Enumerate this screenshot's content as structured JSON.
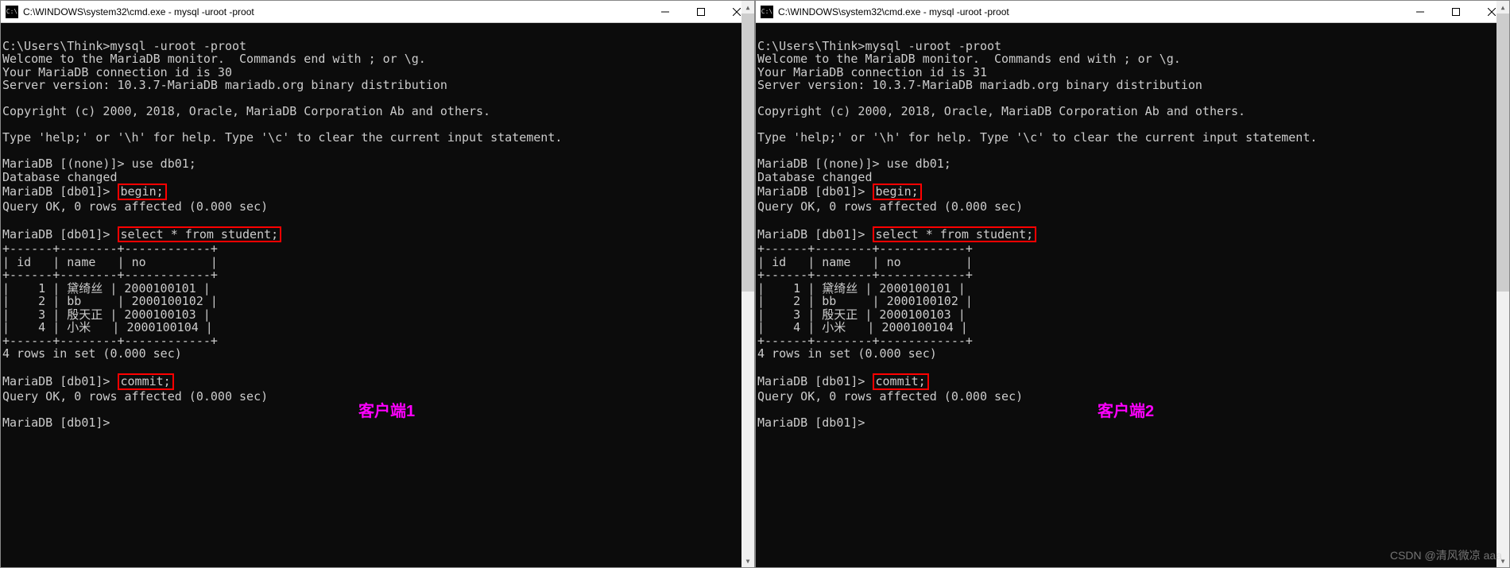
{
  "watermark": "CSDN @清风微凉 aaa",
  "left": {
    "title": "C:\\WINDOWS\\system32\\cmd.exe - mysql  -uroot -proot",
    "icon_label": "C:\\",
    "client_label": "客户端1",
    "session": {
      "login_cmd": "C:\\Users\\Think>mysql -uroot -proot",
      "welcome": "Welcome to the MariaDB monitor.  Commands end with ; or \\g.",
      "conn_id_line": "Your MariaDB connection id is 30",
      "server_version": "Server version: 10.3.7-MariaDB mariadb.org binary distribution",
      "copyright": "Copyright (c) 2000, 2018, Oracle, MariaDB Corporation Ab and others.",
      "help_line": "Type 'help;' or '\\h' for help. Type '\\c' to clear the current input statement.",
      "prompt_none": "MariaDB [(none)]> ",
      "use_cmd": "use db01;",
      "db_changed": "Database changed",
      "prompt_db": "MariaDB [db01]> ",
      "begin_cmd": "begin;",
      "query_ok_begin": "Query OK, 0 rows affected (0.000 sec)",
      "select_cmd": "select * from student;",
      "table": {
        "headers": [
          "id",
          "name",
          "no"
        ],
        "rows": [
          [
            "1",
            "黛绮丝",
            "2000100101"
          ],
          [
            "2",
            "bb",
            "2000100102"
          ],
          [
            "3",
            "殷天正",
            "2000100103"
          ],
          [
            "4",
            "小米",
            "2000100104"
          ]
        ]
      },
      "rows_in_set": "4 rows in set (0.000 sec)",
      "commit_cmd": "commit;",
      "query_ok_commit": "Query OK, 0 rows affected (0.000 sec)",
      "final_prompt": "MariaDB [db01]> "
    }
  },
  "right": {
    "title": "C:\\WINDOWS\\system32\\cmd.exe - mysql  -uroot -proot",
    "icon_label": "C:\\",
    "client_label": "客户端2",
    "session": {
      "login_cmd": "C:\\Users\\Think>mysql -uroot -proot",
      "welcome": "Welcome to the MariaDB monitor.  Commands end with ; or \\g.",
      "conn_id_line": "Your MariaDB connection id is 31",
      "server_version": "Server version: 10.3.7-MariaDB mariadb.org binary distribution",
      "copyright": "Copyright (c) 2000, 2018, Oracle, MariaDB Corporation Ab and others.",
      "help_line": "Type 'help;' or '\\h' for help. Type '\\c' to clear the current input statement.",
      "prompt_none": "MariaDB [(none)]> ",
      "use_cmd": "use db01;",
      "db_changed": "Database changed",
      "prompt_db": "MariaDB [db01]> ",
      "begin_cmd": "begin;",
      "query_ok_begin": "Query OK, 0 rows affected (0.000 sec)",
      "select_cmd": "select * from student;",
      "table": {
        "headers": [
          "id",
          "name",
          "no"
        ],
        "rows": [
          [
            "1",
            "黛绮丝",
            "2000100101"
          ],
          [
            "2",
            "bb",
            "2000100102"
          ],
          [
            "3",
            "殷天正",
            "2000100103"
          ],
          [
            "4",
            "小米",
            "2000100104"
          ]
        ]
      },
      "rows_in_set": "4 rows in set (0.000 sec)",
      "commit_cmd": "commit;",
      "query_ok_commit": "Query OK, 0 rows affected (0.000 sec)",
      "final_prompt": "MariaDB [db01]> "
    }
  }
}
